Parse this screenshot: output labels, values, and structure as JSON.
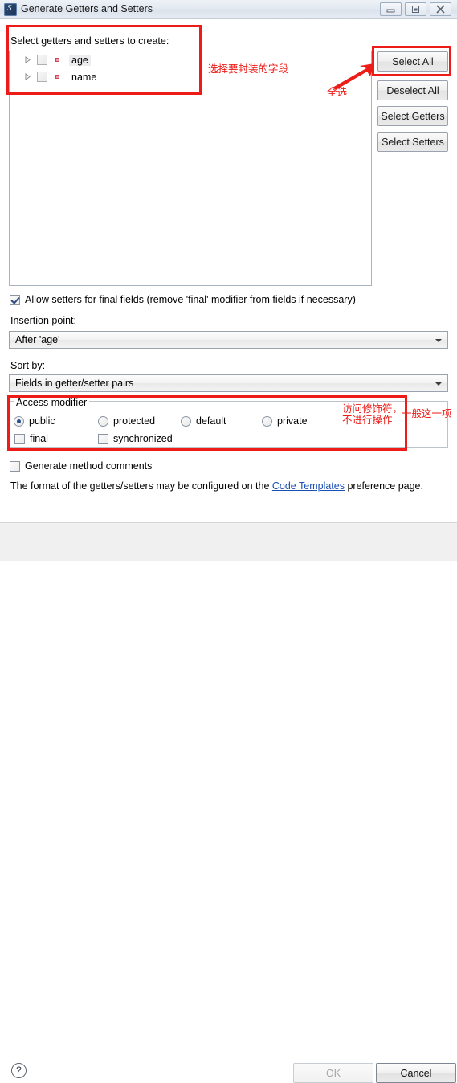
{
  "window": {
    "title": "Generate Getters and Setters",
    "icon": "eclipse-app-icon",
    "controls": {
      "minimize": "minimize-icon",
      "maximize": "restore-icon",
      "close": "close-icon"
    }
  },
  "section": {
    "label": "Select getters and setters to create:"
  },
  "tree": {
    "items": [
      {
        "label": "age",
        "checked": false,
        "selected": true,
        "expandable": true,
        "icon": "field-icon"
      },
      {
        "label": "name",
        "checked": false,
        "selected": false,
        "expandable": true,
        "icon": "field-icon"
      }
    ]
  },
  "side_buttons": {
    "select_all": "Select All",
    "deselect_all": "Deselect All",
    "select_getters": "Select Getters",
    "select_setters": "Select Setters"
  },
  "options": {
    "allow_setters_label": "Allow setters for final fields (remove 'final' modifier from fields if necessary)",
    "allow_setters_checked": true,
    "insertion_point_label": "Insertion point:",
    "insertion_point_value": "After 'age'",
    "sort_by_label": "Sort by:",
    "sort_by_value": "Fields in getter/setter pairs"
  },
  "access_modifier": {
    "legend": "Access modifier",
    "radios": [
      {
        "label": "public",
        "checked": true
      },
      {
        "label": "protected",
        "checked": false
      },
      {
        "label": "default",
        "checked": false
      },
      {
        "label": "private",
        "checked": false
      }
    ],
    "checkboxes": [
      {
        "label": "final",
        "checked": false
      },
      {
        "label": "synchronized",
        "checked": false
      }
    ]
  },
  "footer": {
    "generate_comments_label": "Generate method comments",
    "generate_comments_checked": false,
    "format_note_prefix": "The format of the getters/setters may be configured on the ",
    "format_note_link": "Code Templates",
    "format_note_suffix": " preference page.",
    "help": "?",
    "ok": "OK",
    "ok_enabled": false,
    "cancel": "Cancel"
  },
  "annotations": {
    "color": "#ee1c18",
    "tree_note": "选择要封装的字段",
    "select_all_note": "全选",
    "access_note_line1": "访问修饰符，",
    "access_note_line2": "不进行操作",
    "access_note_right": "一般这一项"
  }
}
